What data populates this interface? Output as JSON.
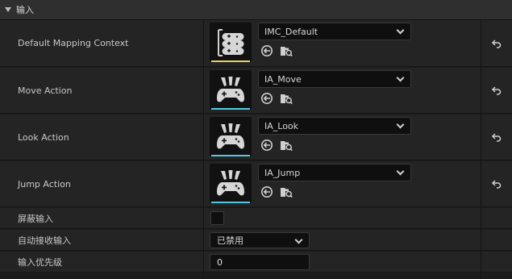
{
  "section": {
    "title": "输入"
  },
  "accent": {
    "imc": "#e6d35a",
    "ia": "#55c9e0"
  },
  "rows": {
    "default_mapping_context": {
      "label": "Default Mapping Context",
      "value": "IMC_Default",
      "icon": "mapping-context-icon"
    },
    "move_action": {
      "label": "Move Action",
      "value": "IA_Move",
      "icon": "input-action-icon"
    },
    "look_action": {
      "label": "Look Action",
      "value": "IA_Look",
      "icon": "input-action-icon"
    },
    "jump_action": {
      "label": "Jump Action",
      "value": "IA_Jump",
      "icon": "input-action-icon"
    },
    "block_input": {
      "label": "屏蔽输入",
      "checked": false
    },
    "auto_receive_input": {
      "label": "自动接收输入",
      "value": "已禁用"
    },
    "input_priority": {
      "label": "输入优先级",
      "value": "0"
    }
  }
}
